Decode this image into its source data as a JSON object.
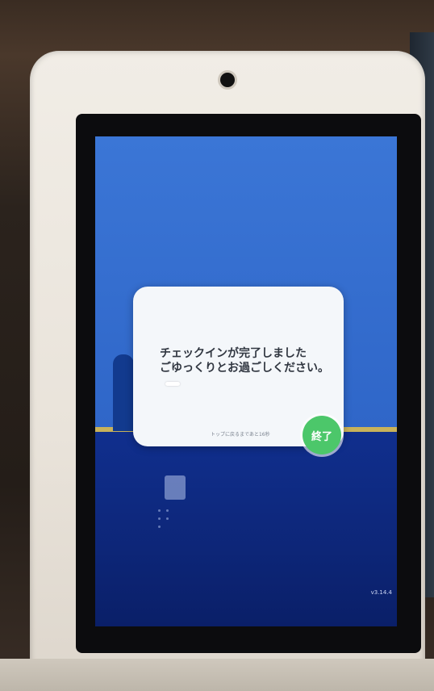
{
  "dialog": {
    "line1": "チェックインが完了しました",
    "line2": "ごゆっくりとお過ごしください。",
    "countdown": "トップに戻るまであと16秒",
    "end_button": "終了"
  },
  "version": "v3.14.4",
  "colors": {
    "screen_blue": "#2f66c8",
    "dialog_bg": "#f4f7fa",
    "end_button_green": "#4cc76a"
  }
}
